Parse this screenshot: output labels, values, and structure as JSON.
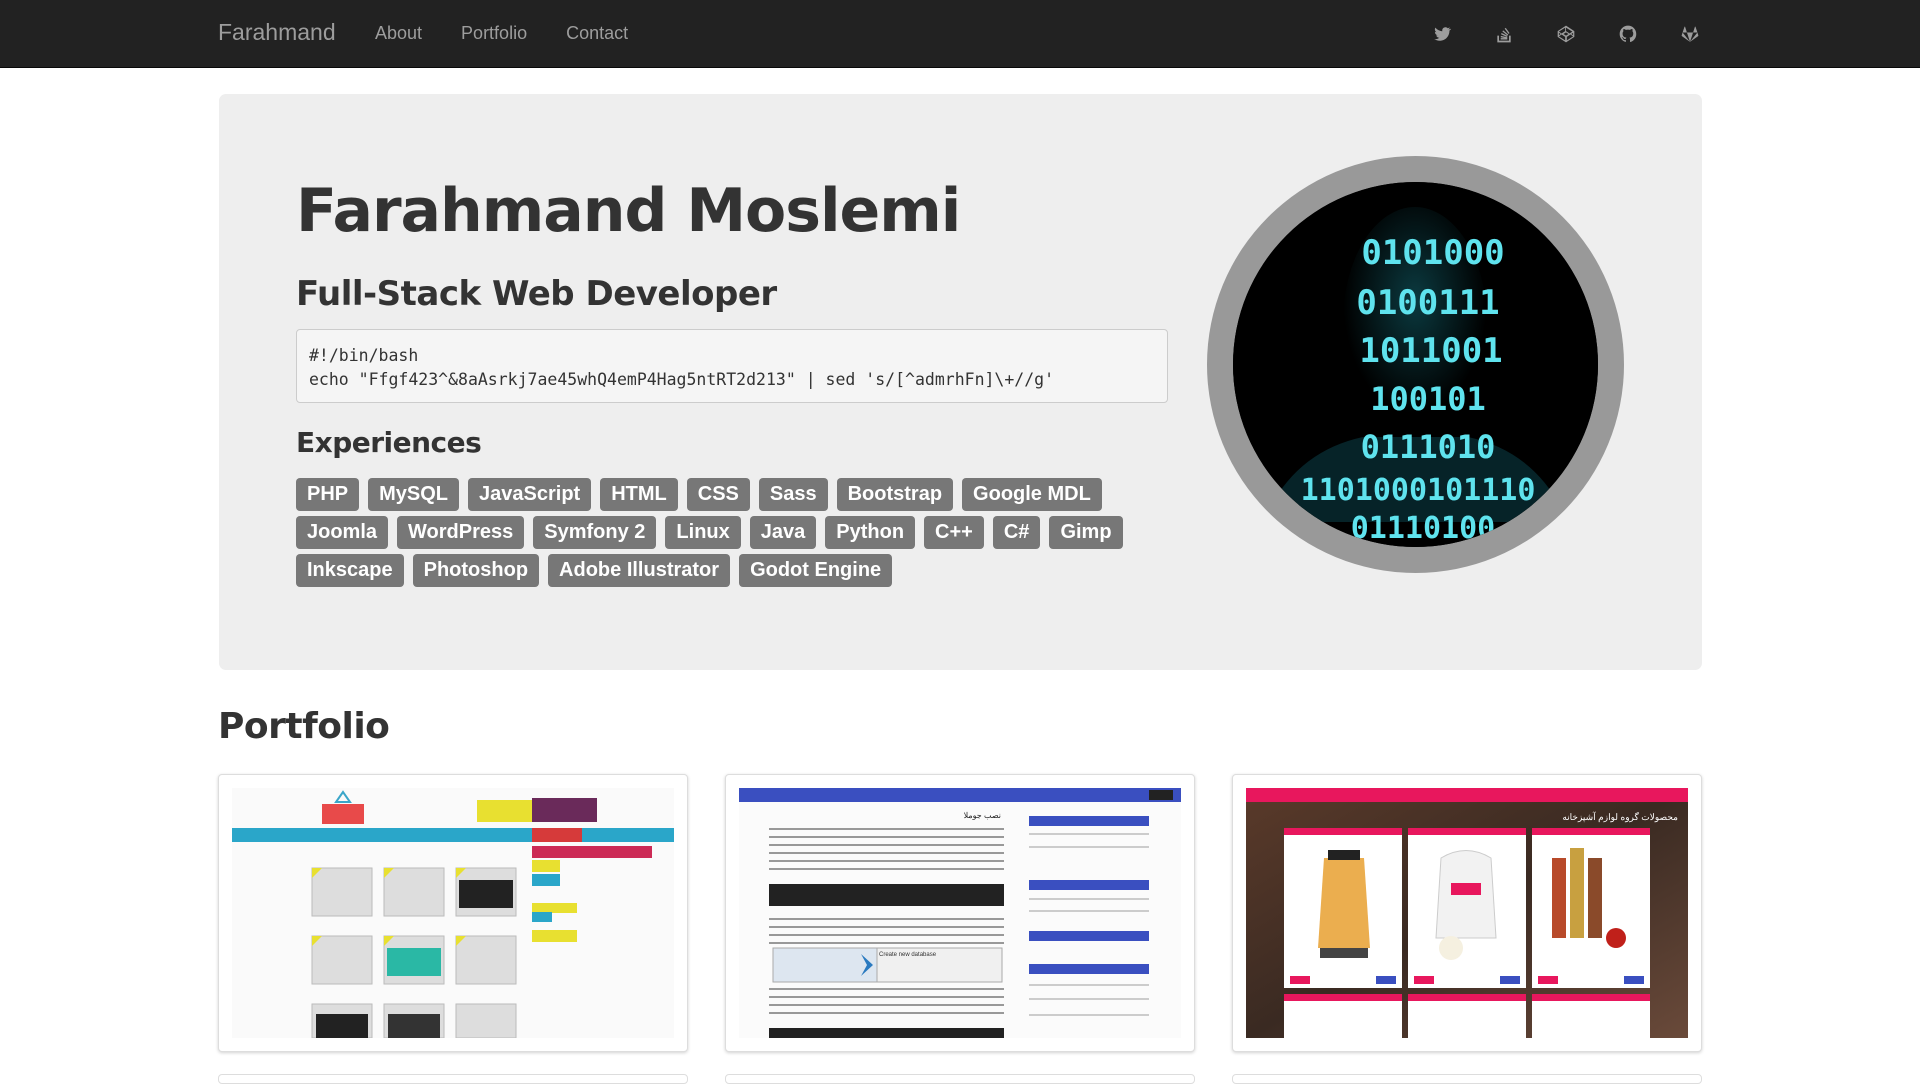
{
  "navbar": {
    "brand": "Farahmand",
    "links": [
      "About",
      "Portfolio",
      "Contact"
    ],
    "icons": [
      "twitter-icon",
      "stackoverflow-icon",
      "codepen-icon",
      "github-icon",
      "gitlab-icon"
    ]
  },
  "hero": {
    "name": "Farahmand Moslemi",
    "role": "Full-Stack Web Developer",
    "code_line1": "#!/bin/bash",
    "code_line2": "echo \"Ffgf423^&8aAsrkj7ae45whQ4emP4Hag5ntRT2d213\" | sed 's/[^admrhFn]\\+//g'",
    "experiences_title": "Experiences",
    "skills": [
      "PHP",
      "MySQL",
      "JavaScript",
      "HTML",
      "CSS",
      "Sass",
      "Bootstrap",
      "Google MDL",
      "Joomla",
      "WordPress",
      "Symfony 2",
      "Linux",
      "Java",
      "Python",
      "C++",
      "C#",
      "Gimp",
      "Inkscape",
      "Photoshop",
      "Adobe Illustrator",
      "Godot Engine"
    ],
    "avatar_digits": [
      "0101000",
      "0100111",
      "1011001",
      "100101",
      "0111010",
      "1101000101110",
      "01110100"
    ]
  },
  "portfolio": {
    "title": "Portfolio",
    "shop_title": "محصولات گروه لوازم آشپزخانه",
    "joomla_title": "نصب جوملا",
    "db_label": "Create new database"
  },
  "colors": {
    "navbar_bg": "#222222",
    "nav_text": "#9d9d9d",
    "jumbotron_bg": "#eeeeee",
    "tag_bg": "#777777",
    "avatar_digits": "#5fe3ee"
  }
}
